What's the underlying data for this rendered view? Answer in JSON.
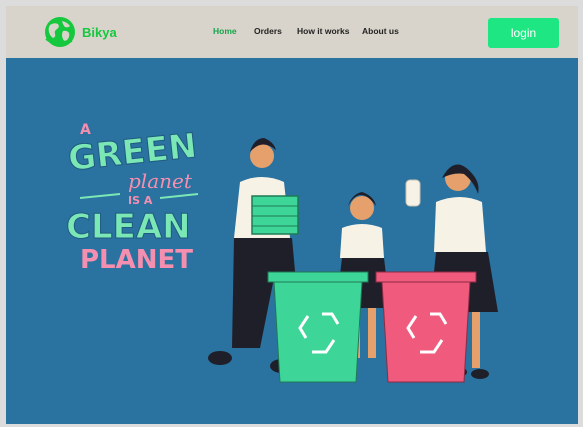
{
  "brand": {
    "name": "Bikya",
    "logo_icon": "globe-icon"
  },
  "nav": {
    "items": [
      {
        "label": "Home",
        "active": true
      },
      {
        "label": "Orders",
        "active": false
      },
      {
        "label": "How it works",
        "active": false
      },
      {
        "label": "About us",
        "active": false
      }
    ]
  },
  "login": {
    "label": "login"
  },
  "hero": {
    "slogan": {
      "line1": "A",
      "line2": "GREEN",
      "line3": "planet",
      "line4": "IS A",
      "line5": "CLEAN",
      "line6": "PLANET"
    },
    "illustration": "people-recycling-illustration",
    "bins": [
      {
        "color": "#3dd598",
        "icon": "recycle-icon"
      },
      {
        "color": "#ef5a7d",
        "icon": "recycle-icon"
      }
    ]
  },
  "colors": {
    "hero_bg": "#2a72a0",
    "brand_green": "#15c83e",
    "login_bg": "#1ee683",
    "slogan_green": "#7be7b4",
    "slogan_pink": "#f58fb0"
  }
}
